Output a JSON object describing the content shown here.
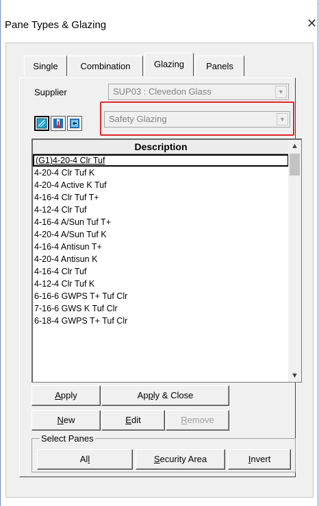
{
  "window": {
    "title": "Pane Types & Glazing",
    "close_glyph": "✕"
  },
  "tabs": [
    {
      "label": "Single",
      "active": false
    },
    {
      "label": "Combination",
      "active": false
    },
    {
      "label": "Glazing",
      "active": true
    },
    {
      "label": "Panels",
      "active": false
    }
  ],
  "supplier": {
    "label": "Supplier",
    "value": "SUP03 : Clevedon Glass"
  },
  "category": {
    "value": "Safety Glazing"
  },
  "toolbar_icons": [
    "glass-pane-icon",
    "thermometer-icon",
    "panel-arrow-icon"
  ],
  "list": {
    "header": "Description",
    "items": [
      "(G1)4-20-4 Clr Tuf",
      "4-20-4 Clr Tuf K",
      "4-20-4 Active K Tuf",
      "4-16-4 Clr Tuf T+",
      "4-12-4 Clr Tuf",
      "4-16-4 A/Sun Tuf T+",
      "4-20-4 A/Sun Tuf K",
      "4-16-4 Antisun T+",
      "4-20-4 Antisun K",
      "4-16-4 Clr Tuf",
      "4-12-4 Clr Tuf K",
      "6-16-6 GWPS T+ Tuf Clr",
      "7-16-6 GWS K Tuf Clr",
      "6-18-4 GWPS T+ Tuf Clr"
    ],
    "selected_index": 0
  },
  "buttons": {
    "apply": {
      "mnemonic": "A",
      "rest": "pply"
    },
    "apply_close": {
      "pre": "Ap",
      "mnemonic": "p",
      "rest": "ly & Close"
    },
    "new": {
      "mnemonic": "N",
      "rest": "ew"
    },
    "edit": {
      "mnemonic": "E",
      "rest": "dit"
    },
    "remove": {
      "mnemonic": "R",
      "rest": "emove"
    }
  },
  "select_panes": {
    "label": "Select Panes",
    "all": {
      "pre": "Al",
      "mnemonic": "l"
    },
    "security": {
      "mnemonic": "S",
      "rest": "ecurity Area"
    },
    "invert": {
      "mnemonic": "I",
      "rest": "nvert"
    }
  },
  "colors": {
    "highlight": "#e2262b",
    "window_border": "#6b8fc7",
    "face": "#f0f0f0"
  }
}
